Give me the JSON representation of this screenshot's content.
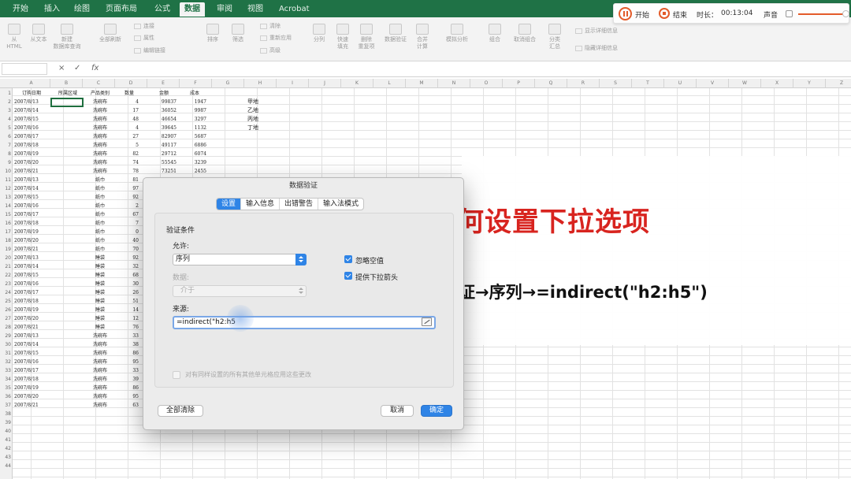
{
  "ribbon": {
    "tabs": [
      "开始",
      "插入",
      "绘图",
      "页面布局",
      "公式",
      "数据",
      "审阅",
      "视图",
      "Acrobat"
    ],
    "active_tab": "数据",
    "items": [
      {
        "label": "从\nHTML"
      },
      {
        "label": "从文本"
      },
      {
        "label": "新建\n数据库查询"
      },
      {
        "label": "全部刷新"
      },
      {
        "label": "排序"
      },
      {
        "label": "筛选"
      },
      {
        "label": "分列"
      },
      {
        "label": "快速\n填充"
      },
      {
        "label": "删除\n重复项"
      },
      {
        "label": "数据验证"
      },
      {
        "label": "合并\n计算"
      },
      {
        "label": "模拟分析"
      },
      {
        "label": "组合"
      },
      {
        "label": "取消组合"
      },
      {
        "label": "分类\n汇总"
      }
    ],
    "small_items": [
      "连接",
      "属性",
      "编辑链接",
      "清除",
      "重新应用",
      "高级",
      "显示详细信息",
      "隐藏详细信息"
    ]
  },
  "recorder": {
    "start_label": "开始",
    "end_label": "结束",
    "duration_label": "时长：",
    "duration": "00:13:04",
    "sound_label": "声音",
    "accent": "#e35b2a"
  },
  "formula_bar": {
    "cancel_icon": "×",
    "confirm_icon": "✓",
    "fx": "fx"
  },
  "sheet": {
    "columns": [
      "A",
      "B",
      "C",
      "D",
      "E",
      "F",
      "G",
      "H",
      "I",
      "J",
      "K",
      "L",
      "M",
      "N",
      "O",
      "P",
      "Q",
      "R",
      "S",
      "T",
      "U",
      "V",
      "W",
      "X",
      "Y",
      "Z"
    ],
    "header_row": [
      "订购日期",
      "所属区域",
      "产品类别",
      "数量",
      "金额",
      "成本"
    ],
    "rows": [
      [
        "2007/8/13",
        "",
        "洗碗布",
        "4",
        "99837",
        "1947"
      ],
      [
        "2007/8/14",
        "",
        "洗碗布",
        "17",
        "36052",
        "9987"
      ],
      [
        "2007/8/15",
        "",
        "洗碗布",
        "48",
        "46654",
        "3297"
      ],
      [
        "2007/8/16",
        "",
        "洗碗布",
        "4",
        "39645",
        "1132"
      ],
      [
        "2007/8/17",
        "",
        "洗碗布",
        "27",
        "82907",
        "5687"
      ],
      [
        "2007/8/18",
        "",
        "洗碗布",
        "5",
        "49117",
        "6886"
      ],
      [
        "2007/8/19",
        "",
        "洗碗布",
        "82",
        "29712",
        "6074"
      ],
      [
        "2007/8/20",
        "",
        "洗碗布",
        "74",
        "55545",
        "3239"
      ],
      [
        "2007/8/21",
        "",
        "洗碗布",
        "78",
        "73251",
        "2455"
      ],
      [
        "2007/8/13",
        "",
        "纸巾",
        "81",
        "",
        ""
      ],
      [
        "2007/8/14",
        "",
        "纸巾",
        "97",
        "",
        ""
      ],
      [
        "2007/8/15",
        "",
        "纸巾",
        "92",
        "",
        ""
      ],
      [
        "2007/8/16",
        "",
        "纸巾",
        "2",
        "",
        ""
      ],
      [
        "2007/8/17",
        "",
        "纸巾",
        "67",
        "",
        ""
      ],
      [
        "2007/8/18",
        "",
        "纸巾",
        "7",
        "",
        ""
      ],
      [
        "2007/8/19",
        "",
        "纸巾",
        "0",
        "",
        ""
      ],
      [
        "2007/8/20",
        "",
        "纸巾",
        "40",
        "",
        ""
      ],
      [
        "2007/8/21",
        "",
        "纸巾",
        "70",
        "",
        ""
      ],
      [
        "2007/8/13",
        "",
        "睡袋",
        "92",
        "",
        ""
      ],
      [
        "2007/8/14",
        "",
        "睡袋",
        "32",
        "",
        ""
      ],
      [
        "2007/8/15",
        "",
        "睡袋",
        "68",
        "",
        ""
      ],
      [
        "2007/8/16",
        "",
        "睡袋",
        "30",
        "",
        ""
      ],
      [
        "2007/8/17",
        "",
        "睡袋",
        "26",
        "",
        ""
      ],
      [
        "2007/8/18",
        "",
        "睡袋",
        "51",
        "",
        ""
      ],
      [
        "2007/8/19",
        "",
        "睡袋",
        "14",
        "",
        ""
      ],
      [
        "2007/8/20",
        "",
        "睡袋",
        "12",
        "",
        ""
      ],
      [
        "2007/8/21",
        "",
        "睡袋",
        "76",
        "",
        ""
      ],
      [
        "2007/8/13",
        "",
        "洗碗布",
        "33",
        "",
        ""
      ],
      [
        "2007/8/14",
        "",
        "洗碗布",
        "38",
        "",
        ""
      ],
      [
        "2007/8/15",
        "",
        "洗碗布",
        "86",
        "",
        ""
      ],
      [
        "2007/8/16",
        "",
        "洗碗布",
        "95",
        "",
        ""
      ],
      [
        "2007/8/17",
        "",
        "洗碗布",
        "33",
        "",
        ""
      ],
      [
        "2007/8/18",
        "",
        "洗碗布",
        "39",
        "",
        ""
      ],
      [
        "2007/8/19",
        "",
        "洗碗布",
        "86",
        "",
        ""
      ],
      [
        "2007/8/20",
        "",
        "洗碗布",
        "95",
        "",
        ""
      ],
      [
        "2007/8/21",
        "",
        "洗碗布",
        "63",
        "",
        ""
      ]
    ],
    "h_column": [
      "甲地",
      "乙地",
      "丙地",
      "丁地"
    ],
    "total_rows": 44
  },
  "overlay": {
    "title": "何设置下拉选项",
    "formula": "证→序列→=indirect(\"h2:h5\")"
  },
  "dialog": {
    "title": "数据验证",
    "tabs": [
      "设置",
      "输入信息",
      "出错警告",
      "输入法模式"
    ],
    "active_tab": "设置",
    "section_label": "验证条件",
    "allow_label": "允许:",
    "allow_value": "序列",
    "data_label": "数据:",
    "data_value": "介于",
    "ignore_blank_label": "忽略空值",
    "ignore_blank_checked": true,
    "dropdown_label": "提供下拉箭头",
    "dropdown_checked": true,
    "source_label": "来源:",
    "source_value": "=indirect(\"h2:h5",
    "apply_all_label": "对有同样设置的所有其他单元格应用这些更改",
    "apply_all_checked": false,
    "clear_button": "全部清除",
    "cancel_button": "取消",
    "ok_button": "确定",
    "accent": "#2f84e6"
  }
}
